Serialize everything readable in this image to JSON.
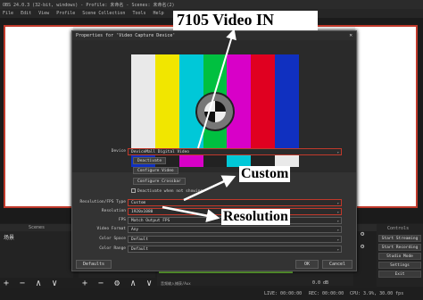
{
  "window": {
    "title": "OBS 24.0.3 (32-bit, windows) - Profile: 未命名 - Scenes: 未命名(2)",
    "menu": [
      "File",
      "Edit",
      "View",
      "Profile",
      "Scene Collection",
      "Tools",
      "Help"
    ]
  },
  "docks": {
    "scenes_header": "Scenes",
    "scene_item": "场景",
    "controls_header": "Controls",
    "controls": [
      "Start Streaming",
      "Start Recording",
      "Studio Mode",
      "Settings",
      "Exit"
    ],
    "mixer_label": "音频输入捕获/Aux",
    "mixer_db": "0.0 dB"
  },
  "statusbar": {
    "live": "LIVE: 00:00:00",
    "rec": "REC: 00:00:00",
    "cpu": "CPU: 3.9%, 30.00 fps"
  },
  "toolbar_glyphs": {
    "scenes": "+  −  ∧  ∨",
    "sources": "+  −  ⚙  ∧  ∨"
  },
  "dialog": {
    "title": "Properties for 'Video Capture Device'",
    "close": "✕",
    "device_label": "Device",
    "device_value": "DeviceMall Digital Video",
    "deactivate": "Deactivate",
    "configure_video": "Configure Video",
    "configure_crossbar": "Configure Crossbar",
    "deactivate_checkbox": "Deactivate when not showing",
    "res_fps_type_label": "Resolution/FPS Type",
    "res_fps_type_value": "Custom",
    "resolution_label": "Resolution",
    "resolution_value": "1920x1080",
    "fps_label": "FPS",
    "fps_value": "Match Output FPS",
    "video_format_label": "Video Format",
    "video_format_value": "Any",
    "color_space_label": "Color Space",
    "color_space_value": "Default",
    "color_range_label": "Color Range",
    "color_range_value": "Default",
    "defaults": "Defaults",
    "ok": "OK",
    "cancel": "Cancel"
  },
  "colorbars": [
    "#e9e9e9",
    "#f1e600",
    "#00c8d8",
    "#00c040",
    "#d800c8",
    "#e00020",
    "#1030c0"
  ],
  "colorbars_bottom": [
    "#1030c0",
    "#222222",
    "#d800c8",
    "#222222",
    "#00c8d8",
    "#222222",
    "#e9e9e9"
  ],
  "annotations": {
    "title": "7105 Video IN",
    "custom": "Custom",
    "resolution": "Resolution"
  },
  "accent_color": "#c0392b"
}
